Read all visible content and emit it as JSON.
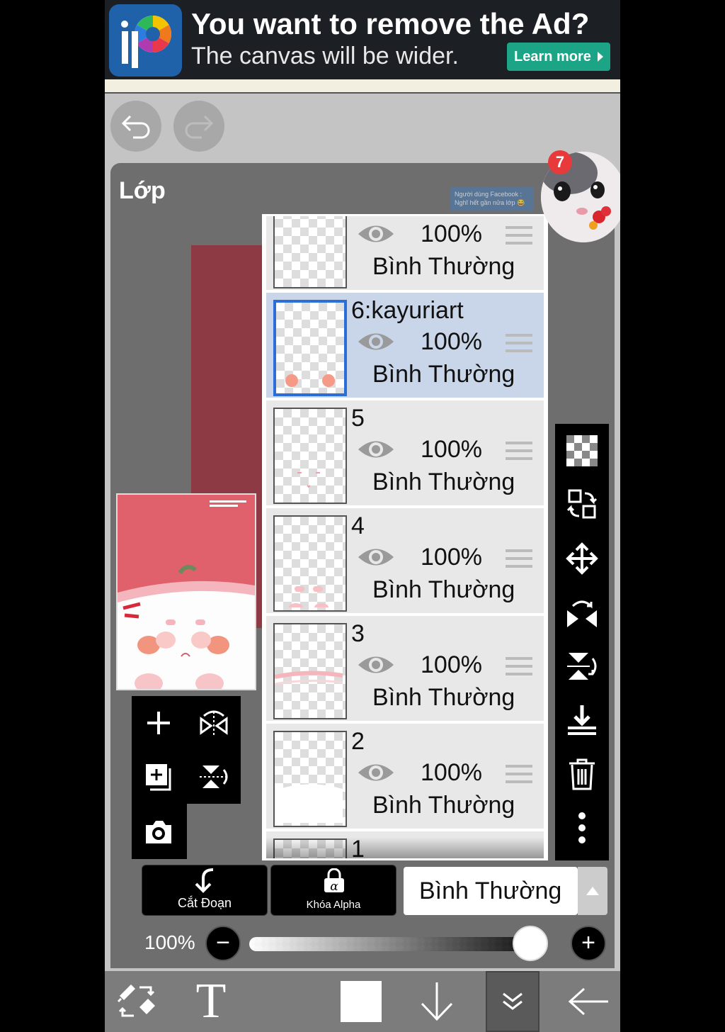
{
  "ad": {
    "title": "You want to remove the Ad?",
    "subtitle": "The canvas will be wider.",
    "learn_more": "Learn more",
    "logo_text": "iP"
  },
  "panel": {
    "title": "Lớp",
    "notification_count": "7",
    "facebook_note": "Người dùng Facebook : Nghĩ hết gần nửa lớp 😂"
  },
  "layers": [
    {
      "name": "",
      "opacity": "100%",
      "blend": "Bình Thường",
      "selected": false
    },
    {
      "name": "6:kayuriart",
      "opacity": "100%",
      "blend": "Bình Thường",
      "selected": true
    },
    {
      "name": "5",
      "opacity": "100%",
      "blend": "Bình Thường",
      "selected": false
    },
    {
      "name": "4",
      "opacity": "100%",
      "blend": "Bình Thường",
      "selected": false
    },
    {
      "name": "3",
      "opacity": "100%",
      "blend": "Bình Thường",
      "selected": false
    },
    {
      "name": "2",
      "opacity": "100%",
      "blend": "Bình Thường",
      "selected": false
    },
    {
      "name": "1",
      "opacity": "",
      "blend": "",
      "selected": false
    }
  ],
  "bottom": {
    "clip_label": "Cắt Đoạn",
    "alpha_lock_label": "Khóa Alpha",
    "blend_mode": "Bình Thường",
    "opacity_label": "100%",
    "opacity_value": 1.0,
    "minus": "−",
    "plus": "+"
  },
  "nav": {
    "text_tool": "T"
  },
  "colors": {
    "selected_row": "#c9d6e9",
    "selected_border": "#2b6fd6",
    "ad_button": "#1ba486",
    "badge": "#e83a3a"
  }
}
